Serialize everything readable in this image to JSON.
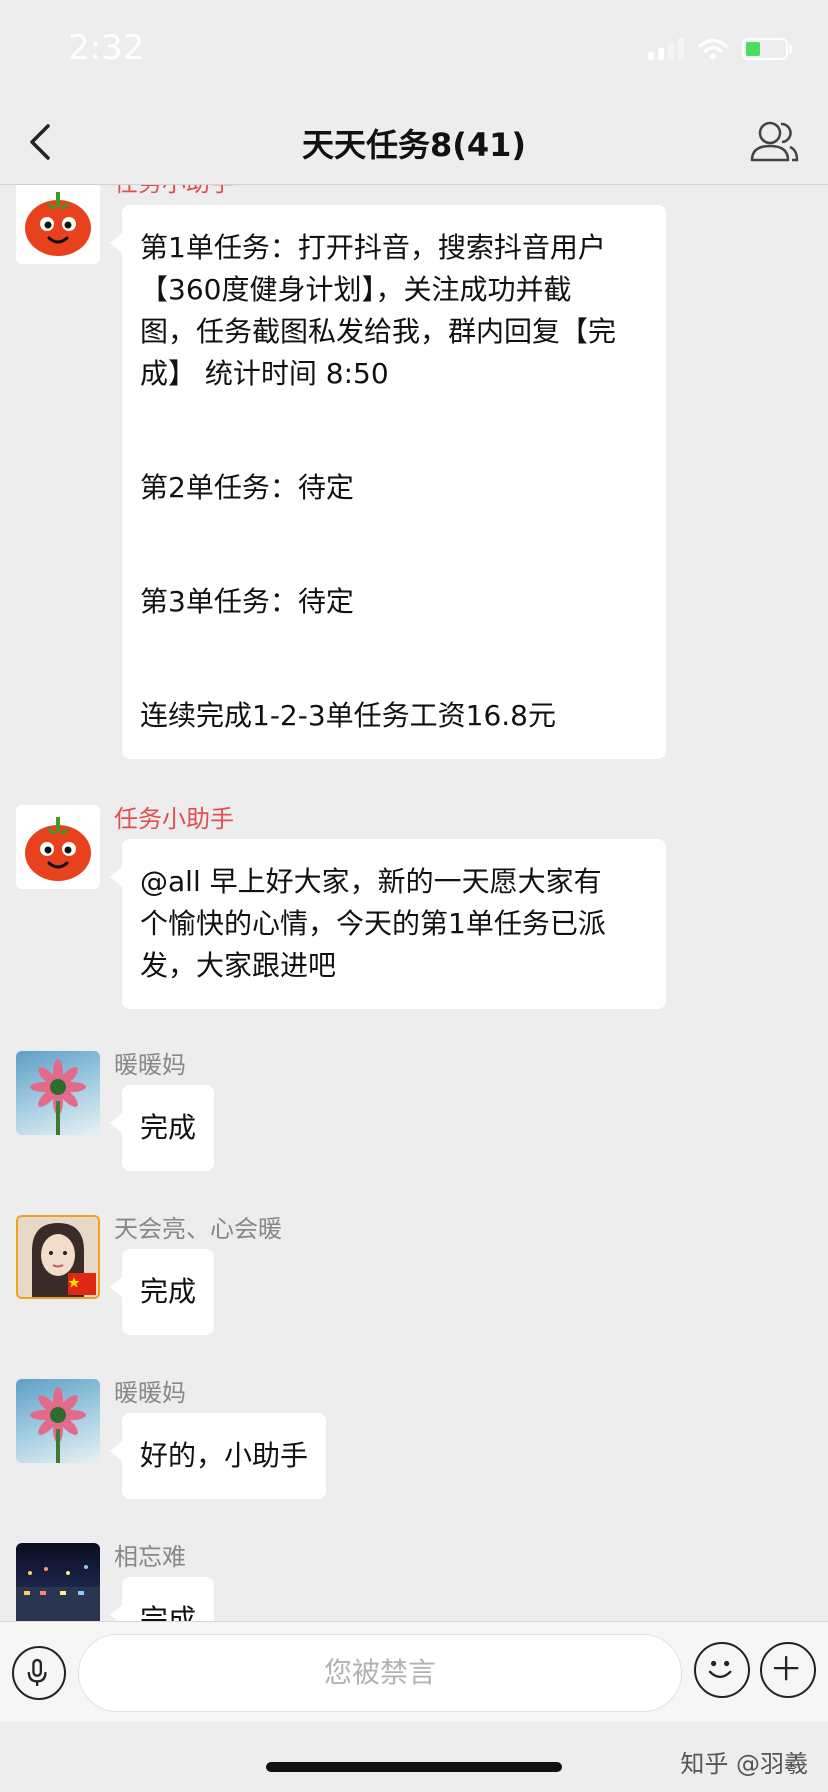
{
  "status_bar": {
    "time": "2:32",
    "signal_icon": "cellular-signal-icon",
    "wifi_icon": "wifi-icon",
    "battery_icon": "battery-charging-icon"
  },
  "nav": {
    "title": "天天任务8(41)",
    "back_icon": "chevron-left-icon",
    "members_icon": "group-members-icon"
  },
  "messages": [
    {
      "sender": "任务小助手",
      "avatar": "tomato-avatar",
      "lines": [
        "第1单任务：打开抖音，搜索抖音用户",
        "【360度健身计划】，关注成功并截",
        "图，任务截图私发给我，群内回复【完",
        "成】 统计时间 8:50",
        "第2单任务：待定",
        "第3单任务：待定",
        "连续完成1-2-3单任务工资16.8元"
      ]
    },
    {
      "sender": "任务小助手",
      "avatar": "tomato-avatar",
      "lines": [
        "@all 早上好大家，新的一天愿大家有",
        "个愉快的心情，今天的第1单任务已派",
        "发，大家跟进吧"
      ]
    },
    {
      "sender": "暖暖妈",
      "avatar": "flower-avatar",
      "text": "完成"
    },
    {
      "sender": "天会亮、心会暖",
      "avatar": "girl-avatar",
      "text": "完成"
    },
    {
      "sender": "暖暖妈",
      "avatar": "flower-avatar",
      "text": "好的，小助手"
    },
    {
      "sender": "相忘难",
      "avatar": "night-city-avatar",
      "text": "完成"
    }
  ],
  "input_bar": {
    "placeholder": "您被禁言",
    "voice_icon": "microphone-icon",
    "emoji_icon": "smiley-icon",
    "plus_icon": "plus-icon"
  },
  "watermark": "知乎 @羽羲",
  "colors": {
    "background": "#ededed",
    "bubble": "#ffffff",
    "sender_highlight": "#e05050",
    "battery_charge": "#4cd964"
  }
}
